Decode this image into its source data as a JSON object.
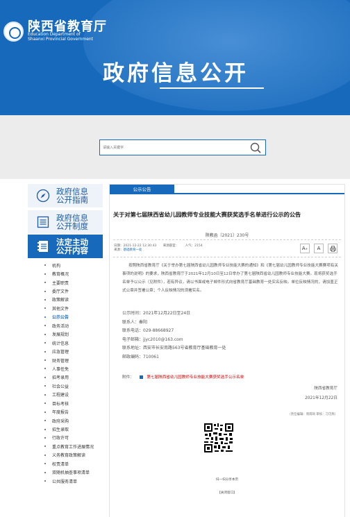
{
  "site": {
    "name_cn": "陕西省教育厅",
    "name_en_line1": "Education Department of",
    "name_en_line2": "Shaanxi Provincial Government",
    "banner_title": "政府信息公开"
  },
  "search": {
    "placeholder": "请输入关键字",
    "button_icon": "search-icon"
  },
  "nav": {
    "cards": [
      {
        "label": "政府信息公开指南",
        "icon": "compass-icon"
      },
      {
        "label": "政府信息公开制度",
        "icon": "document-list-icon"
      },
      {
        "label": "法定主动公开内容",
        "icon": "notebook-icon",
        "active": true
      }
    ],
    "sub_items": [
      "机构",
      "教育概况",
      "主要职责",
      "委厅文件",
      "政策解读",
      "其他文件",
      "公示公告",
      "政务活动",
      "发展规划",
      "统计信息",
      "应急管理",
      "财务管理",
      "人事任免",
      "招考录用",
      "社会公益",
      "工程建设",
      "目标考核",
      "年度报告",
      "政府采购",
      "招生录取",
      "行政许可",
      "重点教育工作进展情况",
      "义务教育政策解读",
      "权责清单",
      "双随机抽查事项清单",
      "公共服务清单"
    ],
    "active_sub": "公示公告"
  },
  "article": {
    "section_tab": "公示公告",
    "title": "关于对第七届陕西省幼儿园教师专业技能大赛获奖选手名单进行公示的公告",
    "doc_number": "陕教函〔2021〕230号",
    "meta": {
      "date": "日期：2021-12-22 12:30:43",
      "author": "来源部室：",
      "views": "人气：2154",
      "source": "来源：",
      "source_link": "基础教育一处"
    },
    "font_buttons": {
      "larger": "A",
      "smaller": "A",
      "print_icon": "printer-icon"
    },
    "body_paragraphs": [
      "按照陕西省教育厅《关于举办第七届陕西省幼儿园教师专业技能大赛的通知》和《第七届幼儿园教师专业技能大赛赛项有关事项的说明》的要求，陕西省教育厅于2021年12月10日至12日举办了第七届陕西省幼儿园教师专业技能大赛。现将获奖选手名单予以公示（见附件），若有异议，请以书面或电子邮件形式向省教育厅基础教育一处实名反映。单位反映情况的，请加盖正式公章并签署公章；个人反映情况的须署实名。"
    ],
    "contact": [
      "公示时间：2021年12月22日至24日",
      "联系人：秦阳",
      "联系电话：029-88668927",
      "电子邮箱：jjyc2010@163.com",
      "联系地址：西安市长安南路563号省教育厅基础教育一处",
      "邮政编码：710061"
    ],
    "attachment_label": "附件：",
    "attachment_link": "第七届陕西省幼儿园教师专业技能大赛获奖选手公示名单",
    "signature_org": "陕西省教育厅",
    "signature_date": "2021年12月22日",
    "editor_line": "（责任编辑：周雨琦   审核：刁巧燕）",
    "qr_caption": "扫一扫分享本页",
    "close_window": "【关闭窗口】"
  },
  "colors": {
    "primary": "#1769bb",
    "link_red": "#cc0000"
  }
}
